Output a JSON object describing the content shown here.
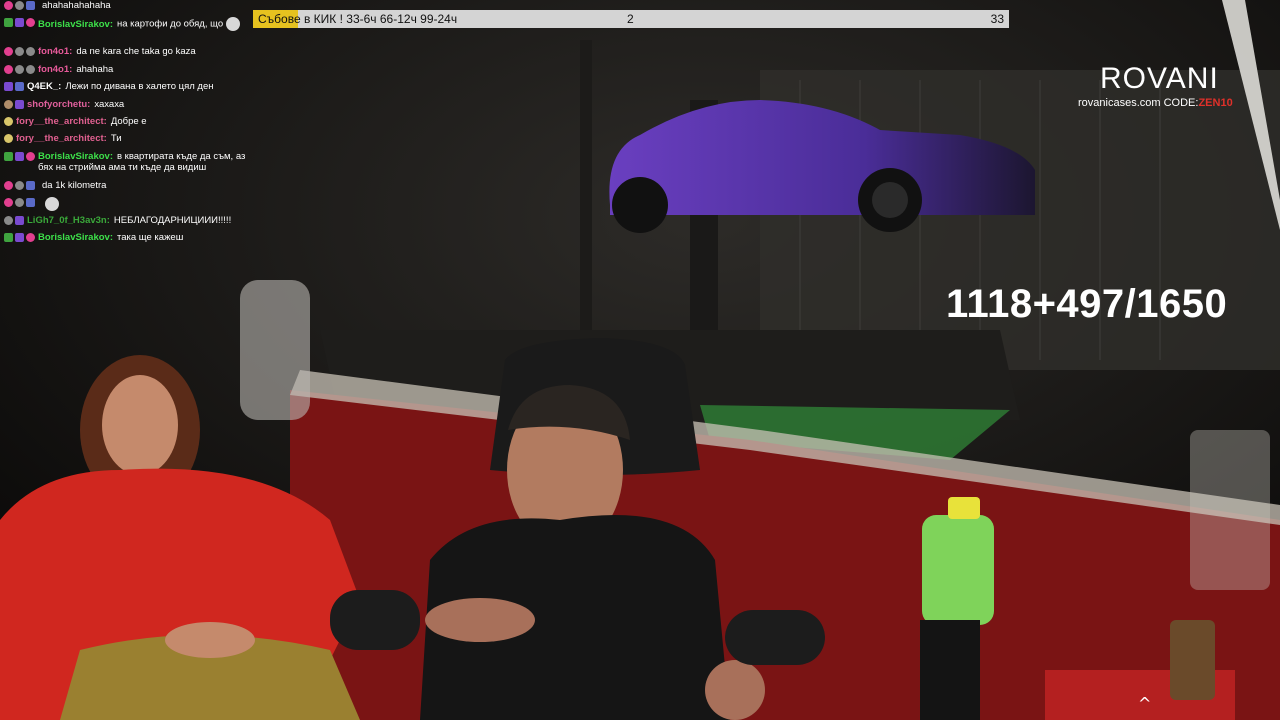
{
  "chat": {
    "messages": [
      {
        "user": "",
        "user_color": "#3a3aa8",
        "text": "ahahahahahaha",
        "badges": [
          "pink",
          "grey",
          "blue"
        ]
      },
      {
        "user": "BorislavSirakov:",
        "user_color": "#3de04a",
        "text": "на картофи до обяд, що",
        "badges": [
          "green",
          "purple",
          "pink"
        ],
        "emote": true
      },
      {
        "user": "fon4o1:",
        "user_color": "#e85a9a",
        "text": "da ne kara che taka go kaza",
        "badges": [
          "pink",
          "grey",
          "grey"
        ]
      },
      {
        "user": "fon4o1:",
        "user_color": "#e85a9a",
        "text": "ahahaha",
        "badges": [
          "pink",
          "grey",
          "grey"
        ]
      },
      {
        "user": "Q4EK_:",
        "user_color": "#ffffff",
        "text": "Лежи по дивана в халето цял ден",
        "badges": [
          "purple",
          "blue"
        ]
      },
      {
        "user": "shofyorchetu:",
        "user_color": "#e0609c",
        "text": "хахаха",
        "badges": [
          "tan",
          "purple"
        ]
      },
      {
        "user": "fory__the_architect:",
        "user_color": "#e06090",
        "text": "Добре е",
        "badges": [
          "yellow"
        ]
      },
      {
        "user": "fory__the_architect:",
        "user_color": "#e06090",
        "text": "Ти",
        "badges": [
          "yellow"
        ]
      },
      {
        "user": "BorislavSirakov:",
        "user_color": "#3de04a",
        "text": "в квартирата къде да съм, аз бях на стрийма ама ти къде да видиш",
        "badges": [
          "green",
          "purple",
          "pink"
        ]
      },
      {
        "user": "",
        "user_color": "#3a3aa8",
        "text": "da 1k kilometra",
        "badges": [
          "pink",
          "grey",
          "blue"
        ]
      },
      {
        "user": "",
        "user_color": "#3a3aa8",
        "text": "",
        "badges": [
          "pink",
          "grey",
          "blue"
        ],
        "emote": true
      },
      {
        "user": "LiGh7_0f_H3av3n:",
        "user_color": "#3aa83a",
        "text": "НЕБЛАГОДАРНИЦИИИ!!!!!",
        "badges": [
          "grey",
          "purple"
        ]
      },
      {
        "user": "BorislavSirakov:",
        "user_color": "#3de04a",
        "text": "така ще кажеш",
        "badges": [
          "green",
          "purple",
          "pink"
        ]
      }
    ]
  },
  "topbar": {
    "title": "Събове в КИК ! 33-6ч 66-12ч 99-24ч",
    "current": "2",
    "goal": "33",
    "progress": 0.06,
    "fill_color": "#e6c21f"
  },
  "sponsor": {
    "brand": "ROVANI",
    "site": "rovanicases.com",
    "code_label": "CODE:",
    "code_value": "ZEN10"
  },
  "counter": {
    "text": "1118+497/1650"
  },
  "icons": {
    "hidden_cursor": "caret-up-icon"
  }
}
